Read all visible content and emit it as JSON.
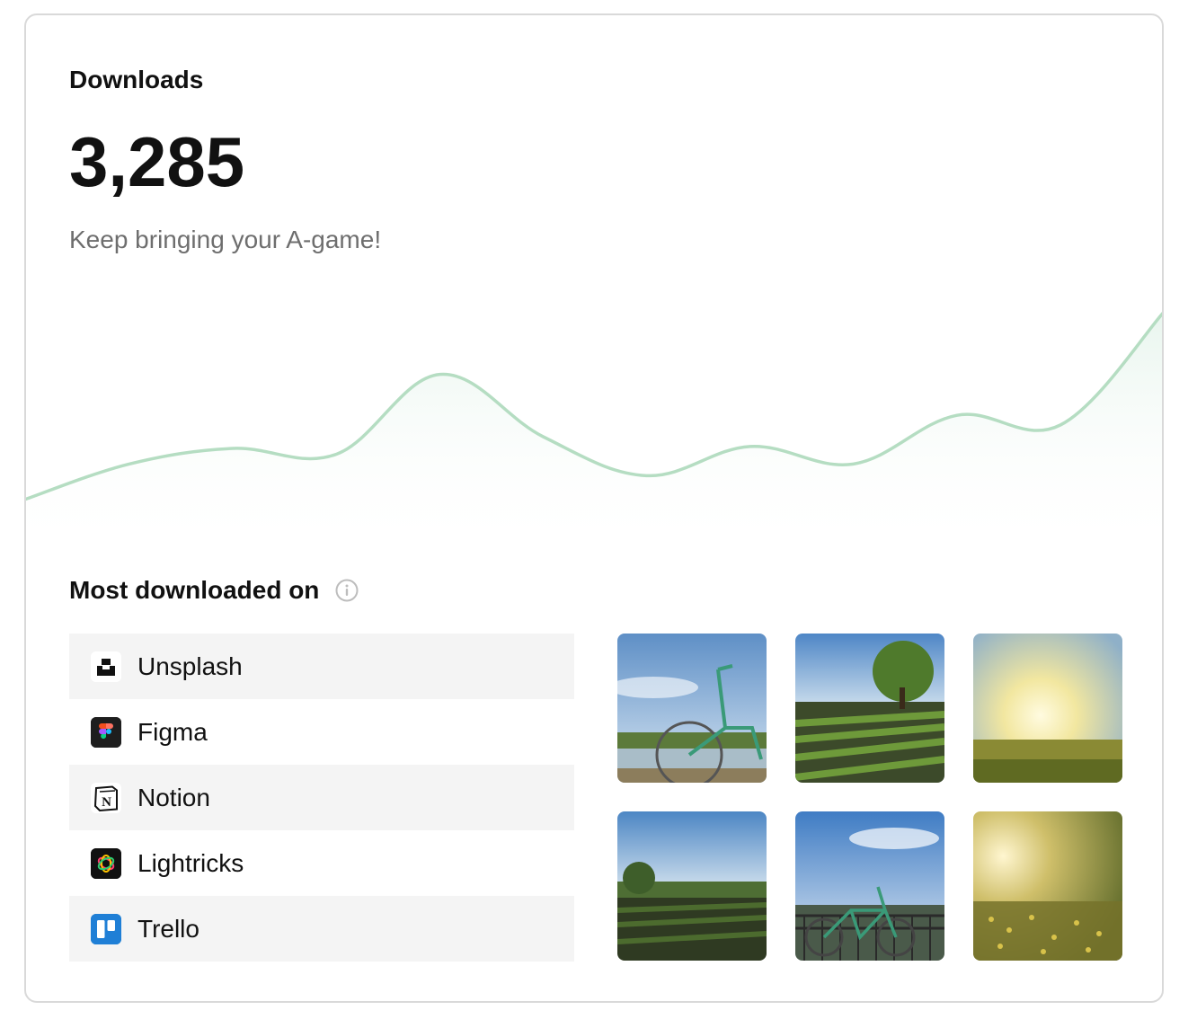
{
  "card": {
    "title": "Downloads",
    "value": "3,285",
    "subtitle": "Keep bringing your A-game!"
  },
  "chart_data": {
    "type": "area",
    "series": [
      {
        "values": [
          10,
          28,
          36,
          33,
          74,
          42,
          22,
          37,
          28,
          53,
          48,
          106
        ]
      }
    ],
    "x": [
      0,
      1,
      2,
      3,
      4,
      5,
      6,
      7,
      8,
      9,
      10,
      11
    ],
    "ylim": [
      0,
      120
    ],
    "grid": false,
    "colors": {
      "line": "#b5ddc2",
      "fill": "#e6f4ec"
    }
  },
  "section": {
    "title": "Most downloaded on",
    "info_icon": "info-circle-icon"
  },
  "apps": [
    {
      "name": "Unsplash",
      "icon": "unsplash-icon"
    },
    {
      "name": "Figma",
      "icon": "figma-icon"
    },
    {
      "name": "Notion",
      "icon": "notion-icon"
    },
    {
      "name": "Lightricks",
      "icon": "lightricks-icon"
    },
    {
      "name": "Trello",
      "icon": "trello-icon"
    }
  ],
  "photos": [
    {
      "subject": "bicycle-by-lake-photo"
    },
    {
      "subject": "tree-and-crop-rows-photo"
    },
    {
      "subject": "sunset-meadow-photo"
    },
    {
      "subject": "green-field-photo"
    },
    {
      "subject": "bicycle-at-railing-photo"
    },
    {
      "subject": "golden-wildflowers-photo"
    }
  ]
}
